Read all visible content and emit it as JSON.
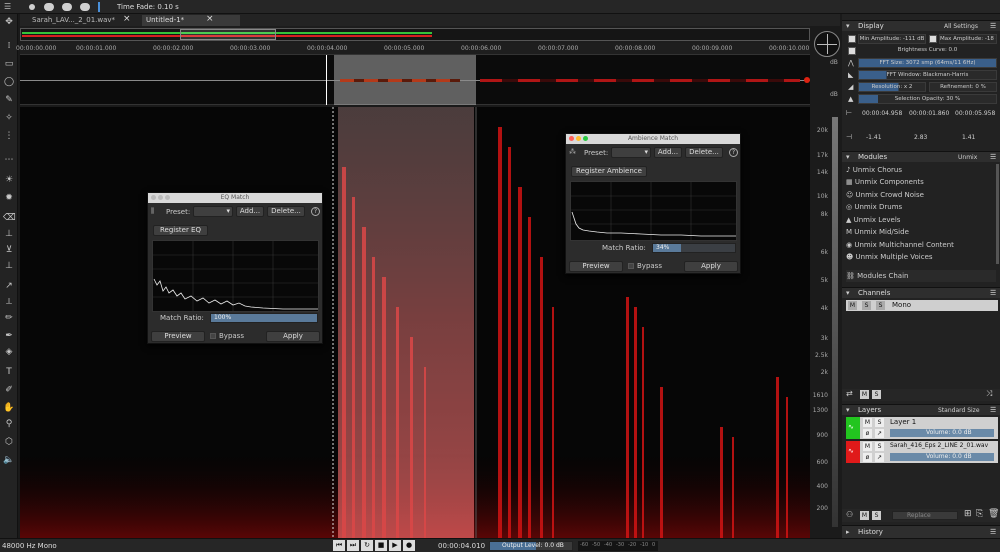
{
  "topbar": {
    "time_fade_label": "Time Fade: 0.10 s"
  },
  "tabs": [
    {
      "label": "Sarah_LAV..._2_01.wav*"
    },
    {
      "label": "Untitled-1*"
    }
  ],
  "ruler": {
    "ticks": [
      "00:00:00.000",
      "00:00:01.000",
      "00:00:02.000",
      "00:00:03.000",
      "00:00:04.000",
      "00:00:05.000",
      "00:00:06.000",
      "00:00:07.000",
      "00:00:08.000",
      "00:00:09.000",
      "00:00:10.000"
    ]
  },
  "db_axis": {
    "top": "dB",
    "bottom": "dB"
  },
  "freq_axis": {
    "labels": [
      "20k",
      "17k",
      "14k",
      "10k",
      "8k",
      "6k",
      "5k",
      "4k",
      "3k",
      "2.5k",
      "2k",
      "1610",
      "1300",
      "900",
      "600",
      "400",
      "200"
    ]
  },
  "eq_match": {
    "title": "EQ Match",
    "preset_label": "Preset:",
    "add_label": "Add...",
    "delete_label": "Delete...",
    "help_label": "?",
    "register_label": "Register EQ",
    "match_ratio_label": "Match Ratio:",
    "match_ratio_value": "100%",
    "match_ratio_fraction": 1.0,
    "preview_label": "Preview",
    "bypass_label": "Bypass",
    "apply_label": "Apply"
  },
  "ambience_match": {
    "title": "Ambience Match",
    "preset_label": "Preset:",
    "add_label": "Add...",
    "delete_label": "Delete...",
    "help_label": "?",
    "register_label": "Register Ambience",
    "match_ratio_label": "Match Ratio:",
    "match_ratio_value": "34%",
    "match_ratio_fraction": 0.34,
    "preview_label": "Preview",
    "bypass_label": "Bypass",
    "apply_label": "Apply"
  },
  "display": {
    "title": "Display",
    "settings_label": "All Settings",
    "min_amp": "Min Amplitude: -111 dB",
    "max_amp": "Max Amplitude: -18 dB",
    "brightness": "Brightness Curve: 0.0",
    "fft_size": "FFT Size: 3072 smp (64ms/11 6Hz)",
    "fft_window": "FFT Window: Blackman-Harris",
    "resolution": "Resolution: x 2",
    "refinement": "Refinement: 0 %",
    "selection_opacity": "Selection Opacity: 30 %",
    "times": [
      "00:00:04.958",
      "00:00:01.860",
      "00:00:05.958"
    ],
    "values": [
      "-1.41",
      "2.83",
      "1.41"
    ]
  },
  "modules": {
    "title": "Modules",
    "filter_label": "Unmix",
    "items": [
      "Unmix Chorus",
      "Unmix Components",
      "Unmix Crowd Noise",
      "Unmix Drums",
      "Unmix Levels",
      "Unmix Mid/Side",
      "Unmix Multichannel Content",
      "Unmix Multiple Voices"
    ],
    "chain_label": "Modules Chain"
  },
  "channels": {
    "title": "Channels",
    "items": [
      {
        "m": "M",
        "s": "S",
        "label": "Mono"
      }
    ]
  },
  "layers": {
    "title": "Layers",
    "size_label": "Standard Size",
    "items": [
      {
        "name": "Layer 1",
        "volume": "Volume: 0.0 dB",
        "color": "#22c51f"
      },
      {
        "name": "Sarah_416_Eps 2_LINE 2_01.wav",
        "volume": "Volume: 0.0 dB",
        "color": "#e01a1a"
      }
    ],
    "blend_label": "Replace"
  },
  "history": {
    "title": "History"
  },
  "status": {
    "format": "48000 Hz Mono",
    "time": "00:00:04.010",
    "output_level": "Output Level: 0.0 dB",
    "meter_ticks": [
      "-60",
      "-50",
      "-40",
      "-30",
      "-20",
      "-10",
      "0"
    ]
  },
  "colors": {
    "accent": "#4a90d9",
    "spectrogram": "#cc1010",
    "layer1": "#22c51f",
    "layer2": "#e01a1a"
  }
}
